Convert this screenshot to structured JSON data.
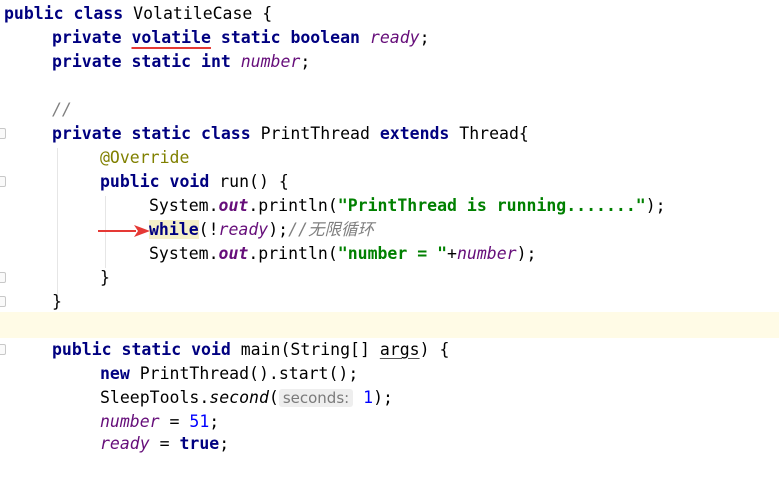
{
  "editor": {
    "accent_red": "#e53935",
    "lines": {
      "l1": {
        "t1": "public class",
        "t2": " VolatileCase {"
      },
      "l2": {
        "t1": "private",
        "t2": "volatile",
        "t3": "static boolean",
        "t4": "ready",
        "t5": ";"
      },
      "l3": {
        "t1": "private static int",
        "t2": "number",
        "t3": ";"
      },
      "l5": {
        "t1": "//"
      },
      "l6": {
        "t1": "private static class",
        "t2": " PrintThread ",
        "t3": "extends",
        "t4": " Thread{"
      },
      "l7": {
        "t1": "@Override"
      },
      "l8": {
        "t1": "public void",
        "t2": " run() {"
      },
      "l9": {
        "t1": "System.",
        "t2": "out",
        "t3": ".println(",
        "t4": "\"PrintThread is running.......\"",
        "t5": ");"
      },
      "l10": {
        "t1": "while",
        "t2": "(!",
        "t3": "ready",
        "t4": ");",
        "t5": "//无限循环"
      },
      "l11": {
        "t1": "System.",
        "t2": "out",
        "t3": ".println(",
        "t4": "\"number = \"",
        "t5": "+",
        "t6": "number",
        "t7": ");"
      },
      "l12": {
        "t1": "}"
      },
      "l13": {
        "t1": "}"
      },
      "l15": {
        "t1": "public static void",
        "t2": " main(String[] ",
        "t3": "args",
        "t4": ") {"
      },
      "l16": {
        "t1": "new",
        "t2": " PrintThread().start();"
      },
      "l17": {
        "t1": "SleepTools.",
        "t2": "second",
        "t3": "(",
        "t4": "seconds:",
        "t5": "1",
        "t6": ");"
      },
      "l18": {
        "t1": "number",
        "t2": " = ",
        "t3": "51",
        "t4": ";"
      },
      "l19": {
        "t1": "ready",
        "t2": " = ",
        "t3": "true",
        "t4": ";"
      }
    }
  }
}
